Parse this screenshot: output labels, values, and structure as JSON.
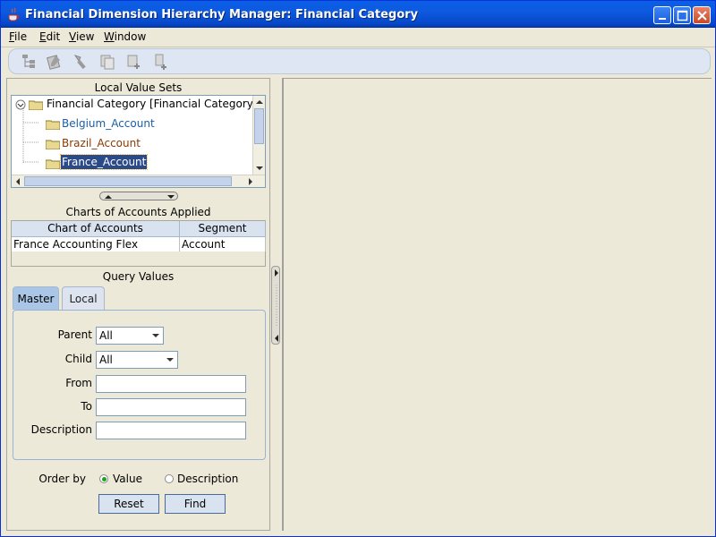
{
  "window": {
    "title": "Financial Dimension Hierarchy Manager: Financial Category"
  },
  "menu": {
    "items": [
      {
        "label": "File",
        "mnemonic": "F",
        "rest": "ile"
      },
      {
        "label": "Edit",
        "mnemonic": "E",
        "rest": "dit"
      },
      {
        "label": "View",
        "mnemonic": "V",
        "rest": "iew"
      },
      {
        "label": "Window",
        "mnemonic": "W",
        "rest": "indow"
      }
    ]
  },
  "toolbar": {
    "icons": [
      "hierarchy-icon",
      "edit-icon",
      "flashlight-icon",
      "copy-icon",
      "add-child-icon",
      "add-sibling-icon"
    ]
  },
  "local_value_sets": {
    "title": "Local Value Sets",
    "root": "Financial Category  [Financial Category]",
    "items": [
      {
        "label": "Belgium_Account",
        "color": "#1a5fa8"
      },
      {
        "label": "Brazil_Account",
        "color": "#8a3a00"
      },
      {
        "label": "France_Account",
        "color": "#ffffff",
        "selected": true
      }
    ]
  },
  "charts_of_accounts": {
    "title": "Charts of Accounts Applied",
    "columns": [
      "Chart of Accounts",
      "Segment"
    ],
    "rows": [
      [
        "France Accounting Flex",
        "Account"
      ]
    ]
  },
  "query_values": {
    "title": "Query Values",
    "tabs": [
      {
        "label": "Master",
        "active": true
      },
      {
        "label": "Local",
        "active": false
      }
    ],
    "fields": {
      "parent_label": "Parent",
      "parent_value": "All",
      "child_label": "Child",
      "child_value": "All",
      "from_label": "From",
      "from_value": "",
      "to_label": "To",
      "to_value": "",
      "description_label": "Description",
      "description_value": ""
    },
    "order_by": {
      "label": "Order by",
      "options": [
        {
          "label": "Value",
          "checked": true
        },
        {
          "label": "Description",
          "checked": false
        }
      ]
    },
    "buttons": {
      "reset": "Reset",
      "find": "Find"
    }
  }
}
